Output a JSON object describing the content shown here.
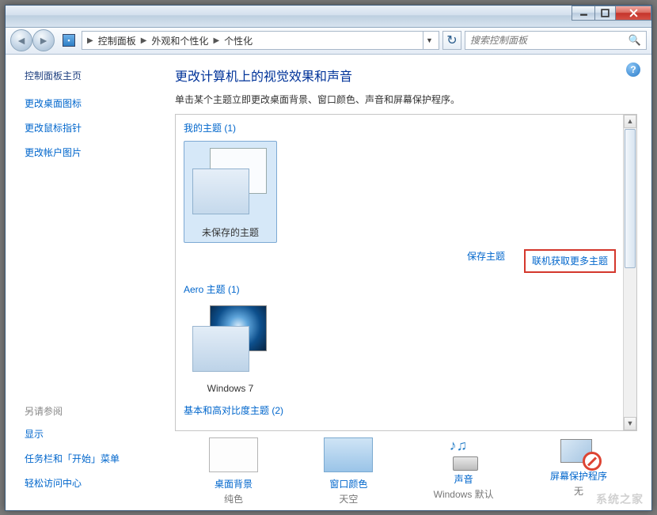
{
  "breadcrumb": {
    "c1": "控制面板",
    "c2": "外观和个性化",
    "c3": "个性化"
  },
  "search": {
    "placeholder": "搜索控制面板"
  },
  "sidebar": {
    "title": "控制面板主页",
    "links": {
      "l1": "更改桌面图标",
      "l2": "更改鼠标指针",
      "l3": "更改帐户图片"
    },
    "seeAlso": "另请参阅",
    "sub": {
      "s1": "显示",
      "s2": "任务栏和「开始」菜单",
      "s3": "轻松访问中心"
    }
  },
  "page": {
    "title": "更改计算机上的视觉效果和声音",
    "desc": "单击某个主题立即更改桌面背景、窗口颜色、声音和屏幕保护程序。"
  },
  "sections": {
    "myThemes": "我的主题 (1)",
    "aeroThemes": "Aero 主题 (1)",
    "basicThemes": "基本和高对比度主题 (2)"
  },
  "themes": {
    "unsaved": "未保存的主题",
    "windows7": "Windows 7"
  },
  "actions": {
    "save": "保存主题",
    "online": "联机获取更多主题"
  },
  "bottom": {
    "bg": {
      "label": "桌面背景",
      "sub": "纯色"
    },
    "color": {
      "label": "窗口颜色",
      "sub": "天空"
    },
    "sound": {
      "label": "声音",
      "sub": "Windows 默认"
    },
    "ss": {
      "label": "屏幕保护程序",
      "sub": "无"
    }
  },
  "watermark": "系统之家"
}
